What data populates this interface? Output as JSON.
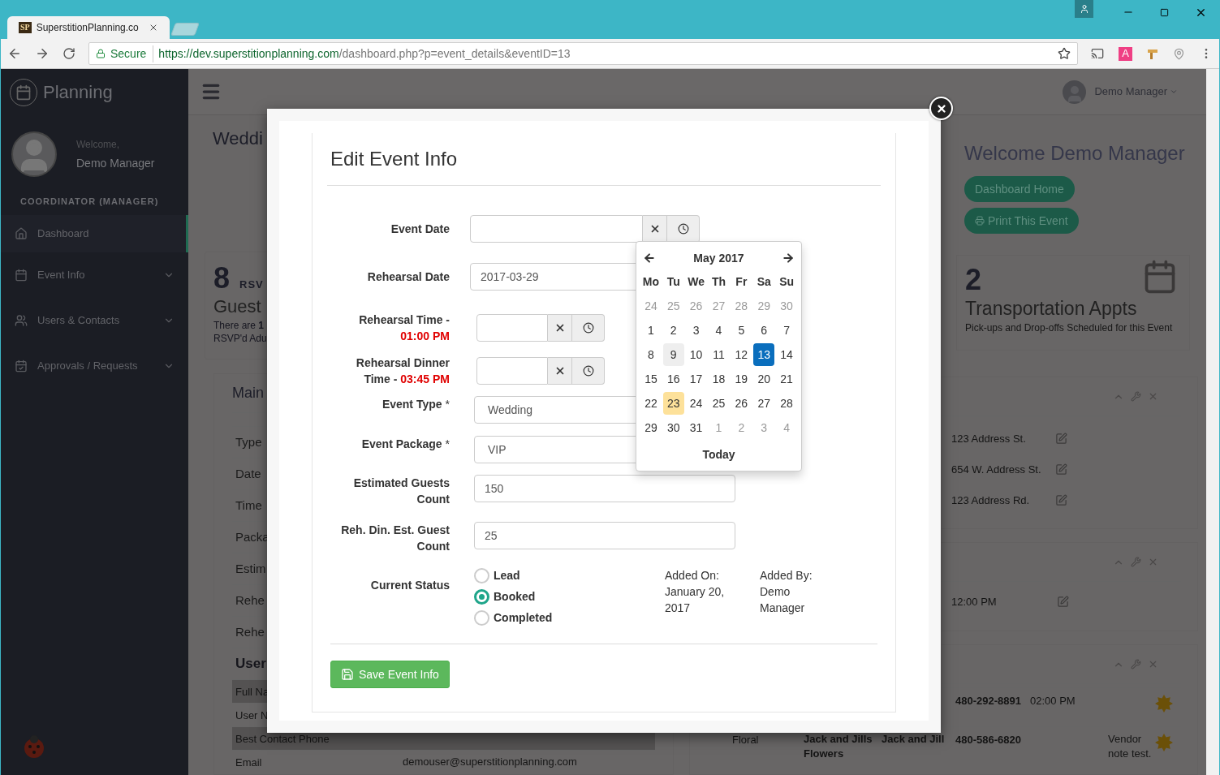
{
  "browser": {
    "favicon_text": "SP",
    "tab_title": "SuperstitionPlanning.co",
    "secure_label": "Secure",
    "url_host": "https://dev.superstitionplanning.com",
    "url_path": "/dashboard.php?p=event_details&eventID=13",
    "extension_badge": "A"
  },
  "sidebar": {
    "brand": "Planning",
    "welcome": "Welcome,",
    "user": "Demo Manager",
    "role": "COORDINATOR (MANAGER)",
    "items": [
      {
        "label": "Dashboard",
        "selected": true,
        "has_submenu": false
      },
      {
        "label": "Event Info",
        "selected": false,
        "has_submenu": true
      },
      {
        "label": "Users & Contacts",
        "selected": false,
        "has_submenu": true
      },
      {
        "label": "Approvals / Requests",
        "selected": false,
        "has_submenu": true
      }
    ]
  },
  "topbar": {
    "user": "Demo Manager"
  },
  "background_left": {
    "title": "Weddi",
    "rsvp_count": "8",
    "rsvp_label": "RSV",
    "guests_title": "Guest",
    "note_lines": [
      "There are **1**",
      "RSVP'd Adu"
    ],
    "panel_title": "Main",
    "rows": [
      "Type",
      "Date",
      "Time",
      "Packa",
      "Estim",
      "Rehe",
      "Rehe"
    ],
    "section": "User",
    "user_rows": [
      {
        "label": "Full Na"
      },
      {
        "label": "User N"
      },
      {
        "label": "Best Contact Phone"
      },
      {
        "label": "Email",
        "value": "demouser@superstitionplanning.com"
      }
    ]
  },
  "background_right": {
    "welcome": "Welcome Demo Manager",
    "buttons": [
      "Dashboard Home",
      "Print This Event"
    ],
    "transport_count": "2",
    "transport_title": "Transportation Appts",
    "transport_subtitle": "Pick-ups and Drop-offs Scheduled for this Event",
    "addresses": [
      "123 Address St.",
      "654 W. Address St.",
      "123 Address Rd."
    ],
    "time": "12:00 PM",
    "contacts": [
      {
        "phone": "480-292-8891",
        "time": "02:00 PM"
      },
      {
        "category": "Floral",
        "vendor": "Jack and Jills Flowers",
        "name": "Jack and Jill",
        "phone": "480-586-6820",
        "note": "Vendor note test."
      }
    ]
  },
  "modal": {
    "title": "Edit Event Info",
    "fields": [
      {
        "kind": "datetime",
        "label": "Event Date"
      },
      {
        "kind": "date",
        "label": "Rehearsal Date",
        "value": "2017-03-29"
      },
      {
        "kind": "time",
        "label": "Rehearsal Time -",
        "time": "01:00 PM"
      },
      {
        "kind": "time",
        "label": "Rehearsal Dinner Time -",
        "time": "03:45 PM"
      },
      {
        "kind": "select",
        "label": "Event Type",
        "required_mark": "*",
        "value": "Wedding"
      },
      {
        "kind": "select",
        "label": "Event Package",
        "required_mark": "*",
        "value": "VIP"
      },
      {
        "kind": "text",
        "label": "Estimated Guests Count",
        "value": "150"
      },
      {
        "kind": "text",
        "label": "Reh. Din. Est. Guest Count",
        "value": "25"
      }
    ],
    "status": {
      "label": "Current Status",
      "options": [
        {
          "label": "Lead",
          "selected": false
        },
        {
          "label": "Booked",
          "selected": true
        },
        {
          "label": "Completed",
          "selected": false
        }
      ],
      "added_on_label": "Added On:",
      "added_on": "January 20, 2017",
      "added_by_label": "Added By:",
      "added_by": "Demo Manager"
    },
    "save_button": "Save Event Info"
  },
  "calendar": {
    "month": "May 2017",
    "weekdays": [
      "Mo",
      "Tu",
      "We",
      "Th",
      "Fr",
      "Sa",
      "Su"
    ],
    "today_button": "Today",
    "weeks": [
      [
        {
          "d": "24",
          "muted": true,
          "selected": false,
          "today": false,
          "hover": false
        },
        {
          "d": "25",
          "muted": true,
          "selected": false,
          "today": false,
          "hover": false
        },
        {
          "d": "26",
          "muted": true,
          "selected": false,
          "today": false,
          "hover": false
        },
        {
          "d": "27",
          "muted": true,
          "selected": false,
          "today": false,
          "hover": false
        },
        {
          "d": "28",
          "muted": true,
          "selected": false,
          "today": false,
          "hover": false
        },
        {
          "d": "29",
          "muted": true,
          "selected": false,
          "today": false,
          "hover": false
        },
        {
          "d": "30",
          "muted": true,
          "selected": false,
          "today": false,
          "hover": false
        }
      ],
      [
        {
          "d": "1",
          "muted": false,
          "selected": false,
          "today": false,
          "hover": false
        },
        {
          "d": "2",
          "muted": false,
          "selected": false,
          "today": false,
          "hover": false
        },
        {
          "d": "3",
          "muted": false,
          "selected": false,
          "today": false,
          "hover": false
        },
        {
          "d": "4",
          "muted": false,
          "selected": false,
          "today": false,
          "hover": false
        },
        {
          "d": "5",
          "muted": false,
          "selected": false,
          "today": false,
          "hover": false
        },
        {
          "d": "6",
          "muted": false,
          "selected": false,
          "today": false,
          "hover": false
        },
        {
          "d": "7",
          "muted": false,
          "selected": false,
          "today": false,
          "hover": false
        }
      ],
      [
        {
          "d": "8",
          "muted": false,
          "selected": false,
          "today": false,
          "hover": false
        },
        {
          "d": "9",
          "muted": false,
          "selected": false,
          "today": false,
          "hover": true
        },
        {
          "d": "10",
          "muted": false,
          "selected": false,
          "today": false,
          "hover": false
        },
        {
          "d": "11",
          "muted": false,
          "selected": false,
          "today": false,
          "hover": false
        },
        {
          "d": "12",
          "muted": false,
          "selected": false,
          "today": false,
          "hover": false
        },
        {
          "d": "13",
          "muted": false,
          "selected": true,
          "today": false,
          "hover": false
        },
        {
          "d": "14",
          "muted": false,
          "selected": false,
          "today": false,
          "hover": false
        }
      ],
      [
        {
          "d": "15",
          "muted": false,
          "selected": false,
          "today": false,
          "hover": false
        },
        {
          "d": "16",
          "muted": false,
          "selected": false,
          "today": false,
          "hover": false
        },
        {
          "d": "17",
          "muted": false,
          "selected": false,
          "today": false,
          "hover": false
        },
        {
          "d": "18",
          "muted": false,
          "selected": false,
          "today": false,
          "hover": false
        },
        {
          "d": "19",
          "muted": false,
          "selected": false,
          "today": false,
          "hover": false
        },
        {
          "d": "20",
          "muted": false,
          "selected": false,
          "today": false,
          "hover": false
        },
        {
          "d": "21",
          "muted": false,
          "selected": false,
          "today": false,
          "hover": false
        }
      ],
      [
        {
          "d": "22",
          "muted": false,
          "selected": false,
          "today": false,
          "hover": false
        },
        {
          "d": "23",
          "muted": false,
          "selected": false,
          "today": true,
          "hover": false
        },
        {
          "d": "24",
          "muted": false,
          "selected": false,
          "today": false,
          "hover": false
        },
        {
          "d": "25",
          "muted": false,
          "selected": false,
          "today": false,
          "hover": false
        },
        {
          "d": "26",
          "muted": false,
          "selected": false,
          "today": false,
          "hover": false
        },
        {
          "d": "27",
          "muted": false,
          "selected": false,
          "today": false,
          "hover": false
        },
        {
          "d": "28",
          "muted": false,
          "selected": false,
          "today": false,
          "hover": false
        }
      ],
      [
        {
          "d": "29",
          "muted": false,
          "selected": false,
          "today": false,
          "hover": false
        },
        {
          "d": "30",
          "muted": false,
          "selected": false,
          "today": false,
          "hover": false
        },
        {
          "d": "31",
          "muted": false,
          "selected": false,
          "today": false,
          "hover": false
        },
        {
          "d": "1",
          "muted": true,
          "selected": false,
          "today": false,
          "hover": false
        },
        {
          "d": "2",
          "muted": true,
          "selected": false,
          "today": false,
          "hover": false
        },
        {
          "d": "3",
          "muted": true,
          "selected": false,
          "today": false,
          "hover": false
        },
        {
          "d": "4",
          "muted": true,
          "selected": false,
          "today": false,
          "hover": false
        }
      ]
    ]
  }
}
